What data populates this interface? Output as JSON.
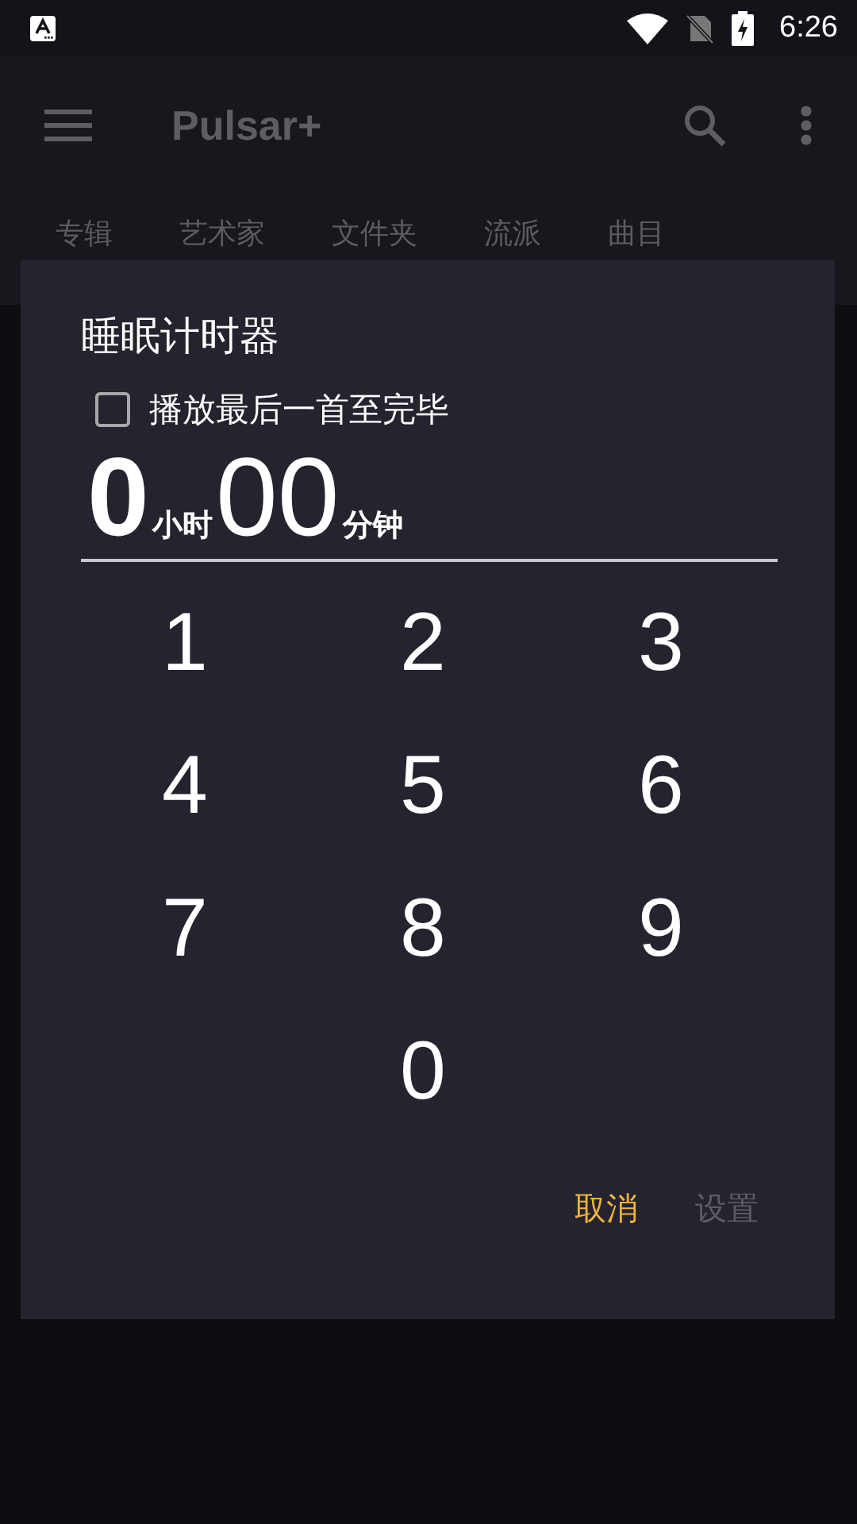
{
  "status_bar": {
    "time": "6:26"
  },
  "app_bar": {
    "title": "Pulsar+"
  },
  "tabs": [
    {
      "label": "专辑"
    },
    {
      "label": "艺术家"
    },
    {
      "label": "文件夹"
    },
    {
      "label": "流派"
    },
    {
      "label": "曲目"
    }
  ],
  "dialog": {
    "title": "睡眠计时器",
    "checkbox": {
      "label": "播放最后一首至完毕",
      "checked": false
    },
    "time": {
      "hours": "0",
      "hours_unit": "小时",
      "minutes": "00",
      "minutes_unit": "分钟"
    },
    "keys": [
      "1",
      "2",
      "3",
      "4",
      "5",
      "6",
      "7",
      "8",
      "9",
      "0"
    ],
    "buttons": [
      {
        "label": "取消",
        "disabled": false
      },
      {
        "label": "设置",
        "disabled": true
      }
    ]
  }
}
